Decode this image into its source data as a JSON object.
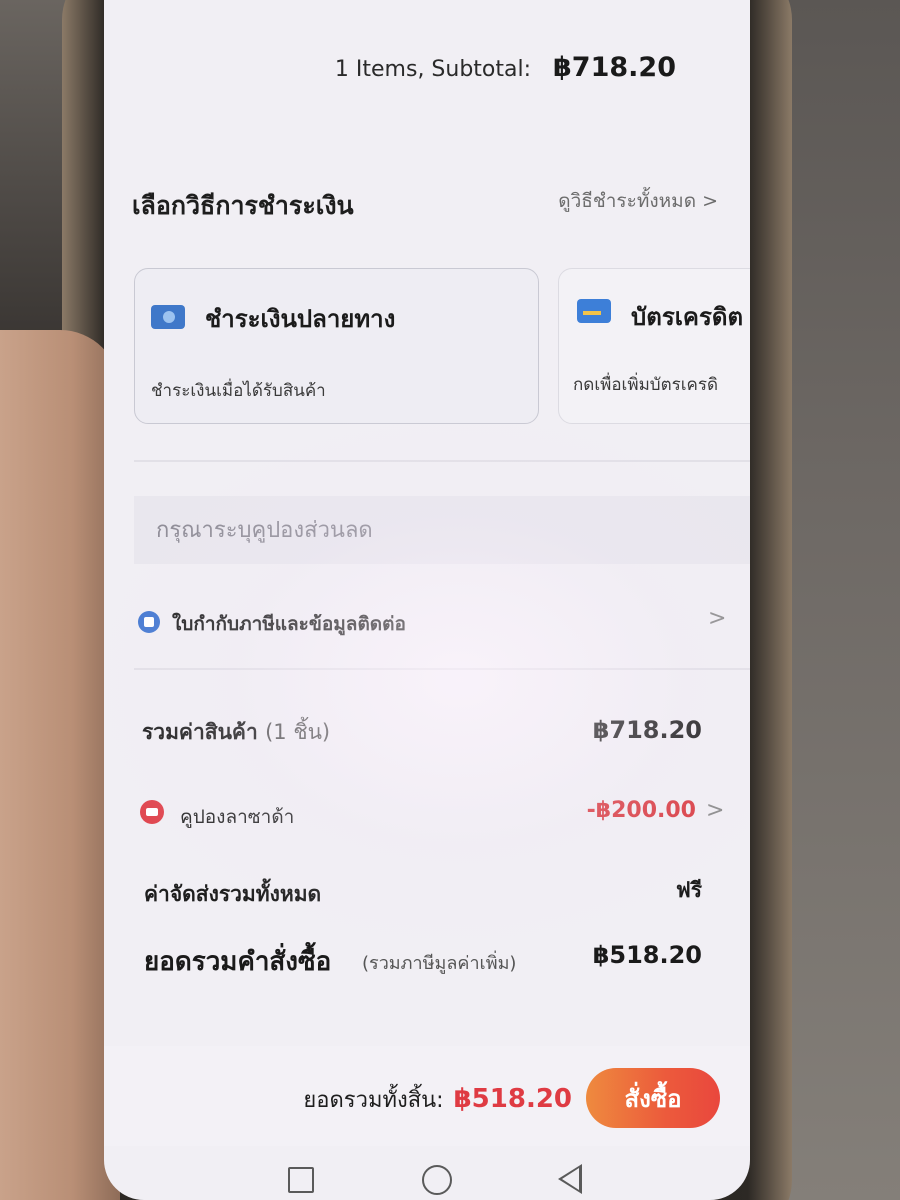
{
  "header": {
    "items_subtotal_label": "1 Items, Subtotal:",
    "subtotal_amount": "฿718.20"
  },
  "payment": {
    "section_title": "เลือกวิธีการชำระเงิน",
    "view_all": "ดูวิธีชำระทั้งหมด >",
    "methods": [
      {
        "title": "ชำระเงินปลายทาง",
        "subtitle": "ชำระเงินเมื่อได้รับสินค้า",
        "icon": "cash-on-delivery-icon",
        "selected": true
      },
      {
        "title": "บัตรเครดิต",
        "subtitle": "กดเพื่อเพิ่มบัตรเครดิ",
        "icon": "credit-card-icon",
        "selected": false
      }
    ]
  },
  "coupon": {
    "placeholder": "กรุณาระบุคูปองส่วนลด"
  },
  "tax_invoice": {
    "label": "ใบกำกับภาษีและข้อมูลติดต่อ",
    "icon": "invoice-icon",
    "chevron": ">"
  },
  "summary": {
    "items_total_label": "รวมค่าสินค้า",
    "items_count": "(1 ชิ้น)",
    "items_total_amount": "฿718.20",
    "lazada_coupon_label": "คูปองลาซาด้า",
    "lazada_coupon_amount": "-฿200.00",
    "lazada_coupon_chevron": ">",
    "shipping_label": "ค่าจัดส่งรวมทั้งหมด",
    "shipping_value": "ฟรี",
    "order_total_label": "ยอดรวมคำสั่งซื้อ",
    "order_total_note": "(รวมภาษีมูลค่าเพิ่ม)",
    "order_total_amount": "฿518.20"
  },
  "footer": {
    "grand_total_label": "ยอดรวมทั้งสิ้น:",
    "grand_total_amount": "฿518.20",
    "place_order_button": "สั่งซื้อ"
  },
  "colors": {
    "accent_red": "#df3b43",
    "button_orange": "#ee8a3e",
    "screen_bg": "#f1eff4",
    "icon_blue": "#4277d1"
  }
}
